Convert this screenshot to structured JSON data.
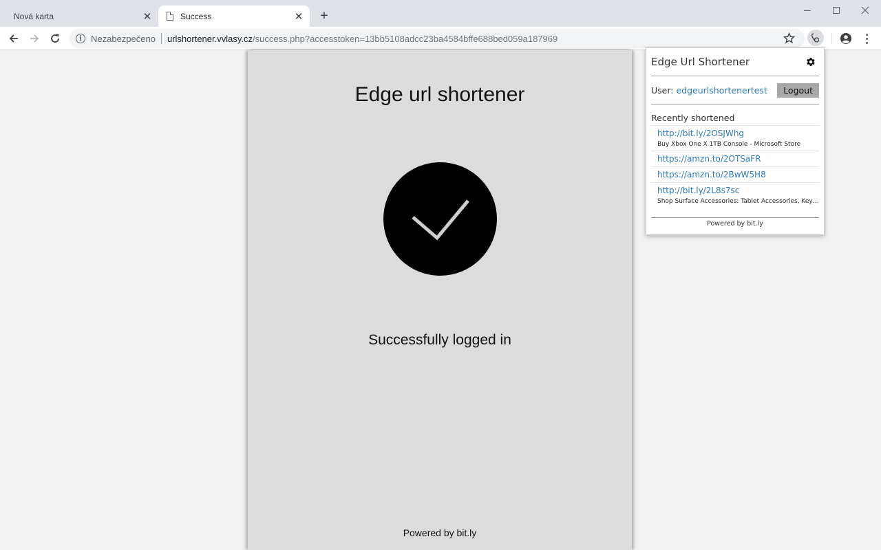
{
  "browser": {
    "tabs": [
      {
        "title": "Nová karta",
        "active": false
      },
      {
        "title": "Success",
        "active": true
      }
    ],
    "address": {
      "security_label": "Nezabezpečeno",
      "host": "urlshortener.vvlasy.cz",
      "path": "/success.php?accesstoken=13bb5108adcc23ba4584bffe688bed059a187969"
    }
  },
  "page": {
    "title": "Edge url shortener",
    "message": "Successfully logged in",
    "footer": "Powered by bit.ly"
  },
  "popup": {
    "title": "Edge Url Shortener",
    "user_label": "User:",
    "username": "edgeurlshortenertest",
    "logout_label": "Logout",
    "recent_heading": "Recently shortened",
    "links": [
      {
        "url": "http://bit.ly/2OSJWhg",
        "title": "Buy Xbox One X 1TB Console - Microsoft Store"
      },
      {
        "url": "https://amzn.to/2OTSaFR",
        "title": ""
      },
      {
        "url": "https://amzn.to/2BwW5H8",
        "title": ""
      },
      {
        "url": "http://bit.ly/2L8s7sc",
        "title": "Shop Surface Accessories: Tablet Accessories, Keyboards, Mice & Pens"
      }
    ],
    "footer": "Powered by bit.ly"
  },
  "icons": {
    "back": "arrow-left-icon",
    "forward": "arrow-right-icon",
    "reload": "reload-icon",
    "info": "info-icon",
    "bookmark": "star-icon",
    "extension": "bitly-extension-icon",
    "profile": "account-circle-icon",
    "menu": "more-vert-icon",
    "settings": "gear-icon",
    "success": "checkmark-icon"
  },
  "colors": {
    "link": "#2e7ab8",
    "card_background": "#dcdcdc",
    "check_circle": "#000000",
    "logout_button": "#a8a8a8"
  }
}
